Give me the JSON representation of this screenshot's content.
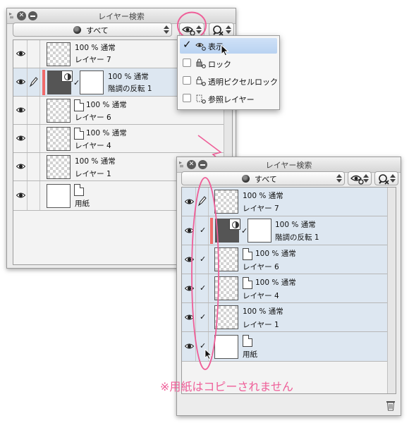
{
  "colors": {
    "accent_pink": "#ef5e98",
    "selection": "#dde7f1",
    "menu_highlight": "#c3d8f4",
    "clip_bar": "#f06a6a"
  },
  "panel_a": {
    "title": "レイヤー検索",
    "filter_label": "すべて",
    "layers": [
      {
        "opacity_mode": "100 % 通常",
        "name": "レイヤー 7"
      },
      {
        "opacity_mode": "100 % 通常",
        "name": "階調の反転 1"
      },
      {
        "opacity_mode": "100 % 通常",
        "name": "レイヤー 6"
      },
      {
        "opacity_mode": "100 % 通常",
        "name": "レイヤー 4"
      },
      {
        "opacity_mode": "100 % 通常",
        "name": "レイヤー 1"
      },
      {
        "opacity_mode": "",
        "name": "用紙"
      }
    ]
  },
  "menu": {
    "items": [
      {
        "label": "表示",
        "icon": "eye-icon",
        "checked": true
      },
      {
        "label": "ロック",
        "icon": "lock-icon",
        "checked": false
      },
      {
        "label": "透明ピクセルロック",
        "icon": "transparent-lock-icon",
        "checked": false
      },
      {
        "label": "参照レイヤー",
        "icon": "reference-layer-icon",
        "checked": false
      }
    ]
  },
  "panel_b": {
    "title": "レイヤー検索",
    "filter_label": "すべて",
    "layers": [
      {
        "opacity_mode": "100 % 通常",
        "name": "レイヤー 7"
      },
      {
        "opacity_mode": "100 % 通常",
        "name": "階調の反転 1"
      },
      {
        "opacity_mode": "100 % 通常",
        "name": "レイヤー 6"
      },
      {
        "opacity_mode": "100 % 通常",
        "name": "レイヤー 4"
      },
      {
        "opacity_mode": "100 % 通常",
        "name": "レイヤー 1"
      },
      {
        "opacity_mode": "",
        "name": "用紙"
      }
    ]
  },
  "annotation": "※用紙はコピーされません"
}
